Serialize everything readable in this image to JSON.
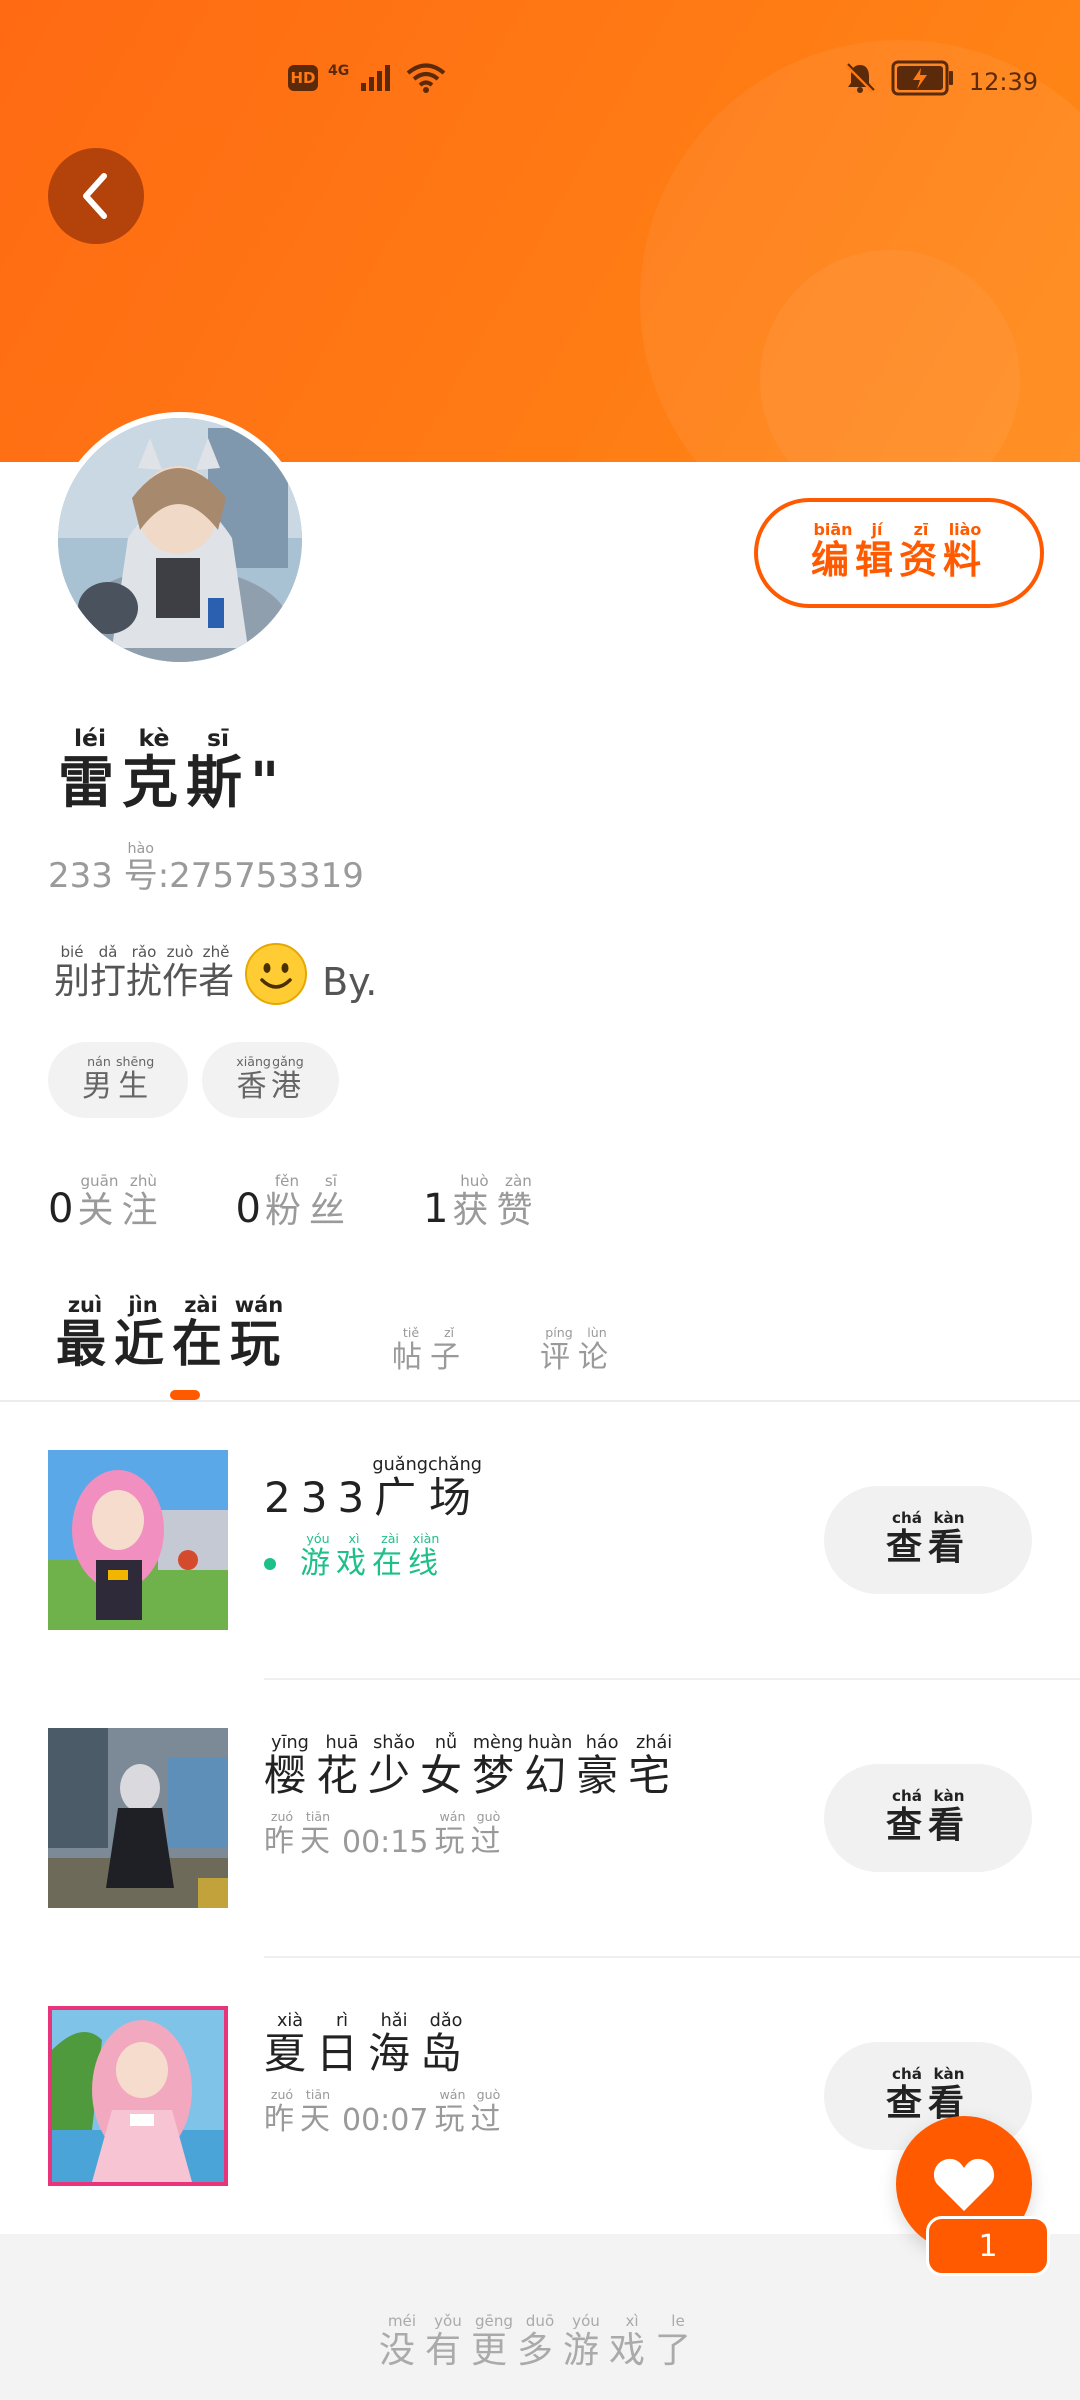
{
  "status_bar": {
    "hd": "HD",
    "network": "4G",
    "time": "12:39"
  },
  "profile": {
    "name_chars": [
      {
        "char": "雷",
        "pinyin": "léi"
      },
      {
        "char": "克",
        "pinyin": "kè"
      },
      {
        "char": "斯",
        "pinyin": "sī"
      }
    ],
    "name_suffix": "\"",
    "account_prefix": "233",
    "account_char": {
      "char": "号",
      "pinyin": "hào"
    },
    "account_number": ":275753319",
    "bio_chars": [
      {
        "char": "别",
        "pinyin": "bié"
      },
      {
        "char": "打",
        "pinyin": "dǎ"
      },
      {
        "char": "扰",
        "pinyin": "rǎo"
      },
      {
        "char": "作",
        "pinyin": "zuò"
      },
      {
        "char": "者",
        "pinyin": "zhě"
      }
    ],
    "bio_suffix": "By.",
    "edit_button": [
      {
        "char": "编",
        "pinyin": "biān"
      },
      {
        "char": "辑",
        "pinyin": "jí"
      },
      {
        "char": "资",
        "pinyin": "zī"
      },
      {
        "char": "料",
        "pinyin": "liào"
      }
    ],
    "tags": [
      [
        {
          "char": "男",
          "pinyin": "nán"
        },
        {
          "char": "生",
          "pinyin": "shēng"
        }
      ],
      [
        {
          "char": "香",
          "pinyin": "xiāng"
        },
        {
          "char": "港",
          "pinyin": "gǎng"
        }
      ]
    ]
  },
  "stats": [
    {
      "value": "0",
      "label": [
        {
          "char": "关",
          "pinyin": "guān"
        },
        {
          "char": "注",
          "pinyin": "zhù"
        }
      ]
    },
    {
      "value": "0",
      "label": [
        {
          "char": "粉",
          "pinyin": "fěn"
        },
        {
          "char": "丝",
          "pinyin": "sī"
        }
      ]
    },
    {
      "value": "1",
      "label": [
        {
          "char": "获",
          "pinyin": "huò"
        },
        {
          "char": "赞",
          "pinyin": "zàn"
        }
      ]
    }
  ],
  "tabs": [
    {
      "label": [
        {
          "char": "最",
          "pinyin": "zuì"
        },
        {
          "char": "近",
          "pinyin": "jìn"
        },
        {
          "char": "在",
          "pinyin": "zài"
        },
        {
          "char": "玩",
          "pinyin": "wán"
        }
      ],
      "active": true
    },
    {
      "label": [
        {
          "char": "帖",
          "pinyin": "tiě"
        },
        {
          "char": "子",
          "pinyin": "zǐ"
        }
      ],
      "active": false
    },
    {
      "label": [
        {
          "char": "评",
          "pinyin": "píng"
        },
        {
          "char": "论",
          "pinyin": "lùn"
        }
      ],
      "active": false
    }
  ],
  "games": [
    {
      "title_prefix": "233",
      "title": [
        {
          "char": "广",
          "pinyin": "guǎng"
        },
        {
          "char": "场",
          "pinyin": "chǎng"
        }
      ],
      "status_online": true,
      "status_prefix": "",
      "status": [
        {
          "char": "游",
          "pinyin": "yóu"
        },
        {
          "char": "戏",
          "pinyin": "xì"
        },
        {
          "char": "在",
          "pinyin": "zài"
        },
        {
          "char": "线",
          "pinyin": "xiàn"
        }
      ],
      "button": [
        {
          "char": "查",
          "pinyin": "chá"
        },
        {
          "char": "看",
          "pinyin": "kàn"
        }
      ]
    },
    {
      "title_prefix": "",
      "title": [
        {
          "char": "樱",
          "pinyin": "yīng"
        },
        {
          "char": "花",
          "pinyin": "huā"
        },
        {
          "char": "少",
          "pinyin": "shǎo"
        },
        {
          "char": "女",
          "pinyin": "nǚ"
        },
        {
          "char": "梦",
          "pinyin": "mèng"
        },
        {
          "char": "幻",
          "pinyin": "huàn"
        },
        {
          "char": "豪",
          "pinyin": "háo"
        },
        {
          "char": "宅",
          "pinyin": "zhái"
        }
      ],
      "status_online": false,
      "status_day": [
        {
          "char": "昨",
          "pinyin": "zuó"
        },
        {
          "char": "天",
          "pinyin": "tiān"
        }
      ],
      "status_time": "00:15",
      "status": [
        {
          "char": "玩",
          "pinyin": "wán"
        },
        {
          "char": "过",
          "pinyin": "guò"
        }
      ],
      "button": [
        {
          "char": "查",
          "pinyin": "chá"
        },
        {
          "char": "看",
          "pinyin": "kàn"
        }
      ]
    },
    {
      "title_prefix": "",
      "title": [
        {
          "char": "夏",
          "pinyin": "xià"
        },
        {
          "char": "日",
          "pinyin": "rì"
        },
        {
          "char": "海",
          "pinyin": "hǎi"
        },
        {
          "char": "岛",
          "pinyin": "dǎo"
        }
      ],
      "status_online": false,
      "status_day": [
        {
          "char": "昨",
          "pinyin": "zuó"
        },
        {
          "char": "天",
          "pinyin": "tiān"
        }
      ],
      "status_time": "00:07",
      "status": [
        {
          "char": "玩",
          "pinyin": "wán"
        },
        {
          "char": "过",
          "pinyin": "guò"
        }
      ],
      "button": [
        {
          "char": "查",
          "pinyin": "chá"
        },
        {
          "char": "看",
          "pinyin": "kàn"
        }
      ]
    }
  ],
  "like_fab": {
    "count": "1"
  },
  "footer": {
    "text": [
      {
        "char": "没",
        "pinyin": "méi"
      },
      {
        "char": "有",
        "pinyin": "yǒu"
      },
      {
        "char": "更",
        "pinyin": "gēng"
      },
      {
        "char": "多",
        "pinyin": "duō"
      },
      {
        "char": "游",
        "pinyin": "yóu"
      },
      {
        "char": "戏",
        "pinyin": "xì"
      },
      {
        "char": "了",
        "pinyin": "le"
      }
    ]
  },
  "colors": {
    "brand": "#ff5a00",
    "online": "#1ec08a"
  }
}
